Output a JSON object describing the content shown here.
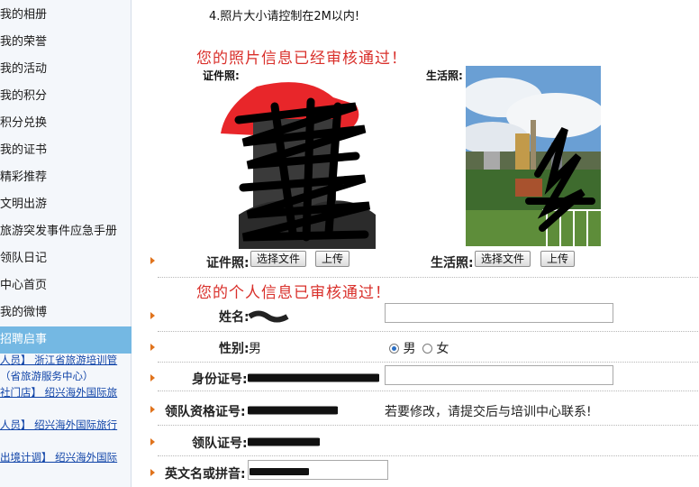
{
  "sidebar": {
    "items": [
      {
        "label": "我的相册"
      },
      {
        "label": "我的荣誉"
      },
      {
        "label": "我的活动"
      },
      {
        "label": "我的积分"
      },
      {
        "label": "积分兑换"
      },
      {
        "label": "我的证书"
      },
      {
        "label": "精彩推荐"
      },
      {
        "label": "文明出游"
      },
      {
        "label": "旅游突发事件应急手册"
      },
      {
        "label": "领队日记"
      },
      {
        "label": "中心首页"
      },
      {
        "label": "我的微博"
      },
      {
        "label": "招聘启事"
      }
    ],
    "news": [
      "人员】 浙江省旅游培训管",
      "（省旅游服务中心）",
      "社门店】 绍兴海外国际旅",
      "人员】 绍兴海外国际旅行",
      "出境计调】 绍兴海外国际"
    ]
  },
  "photo_section": {
    "note": "4.照片大小请控制在2M以内!",
    "status": "您的照片信息已经审核通过！",
    "id_photo_caption": "证件照:",
    "life_photo_caption": "生活照:",
    "id_photo_label": "证件照:",
    "life_photo_label": "生活照:",
    "choose_file": "选择文件",
    "upload": "上传"
  },
  "personal_section": {
    "status": "您的个人信息已审核通过！",
    "name_label": "姓名:",
    "gender_label": "性别:",
    "gender_value": "男",
    "gender_options": [
      "男",
      "女"
    ],
    "id_label": "身份证号:",
    "cert_label": "领队资格证号:",
    "cert_note": "若要修改，请提交后与培训中心联系!",
    "leader_label": "领队证号:",
    "english_label": "英文名或拼音:"
  },
  "colors": {
    "accent_red": "#d9302b",
    "active_nav": "#74b8e3",
    "bullet": "#e0731c"
  }
}
